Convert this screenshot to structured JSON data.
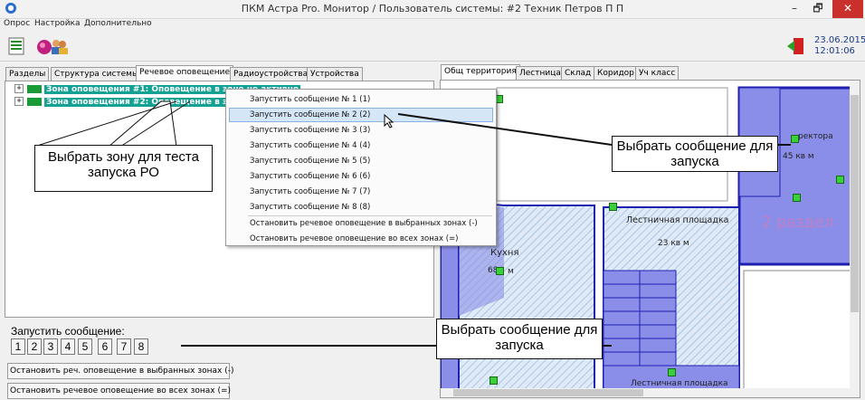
{
  "window": {
    "title": "ПКМ Астра Pro. Монитор / Пользователь системы: #2 Техник Петров П П",
    "controls": {
      "minimize": "–",
      "restore": "🗗",
      "close": "✕"
    }
  },
  "menu": [
    "Опрос",
    "Настройка",
    "Дополнительно"
  ],
  "toolbar": {
    "icons": [
      "list-icon",
      "globe-icon",
      "users-icon",
      "exit-icon"
    ],
    "date": "23.06.2015",
    "time": "12:01:06"
  },
  "left_tabs": [
    "Разделы",
    "Структура системы",
    "Речевое оповещение",
    "Радиоустройства",
    "Устройства"
  ],
  "tree": [
    {
      "label": "Зона оповещения #1: Оповещение в зоне не активно"
    },
    {
      "label": "Зона оповещения #2: Оповещение в зоне не активно"
    }
  ],
  "context_menu": {
    "items": [
      "Запустить сообщение № 1 (1)",
      "Запустить сообщение № 2 (2)",
      "Запустить сообщение № 3 (3)",
      "Запустить сообщение № 4 (4)",
      "Запустить сообщение № 5 (5)",
      "Запустить сообщение № 6 (6)",
      "Запустить сообщение № 7 (7)",
      "Запустить сообщение № 8 (8)"
    ],
    "stop_selected": "Остановить речевое оповещение в выбранных зонах (-)",
    "stop_all": "Остановить речевое оповещение во всех зонах (=)"
  },
  "callouts": {
    "zone": "Выбрать зону для теста запуска РО",
    "message_top": "Выбрать сообщение для запуска",
    "message_bottom": "Выбрать сообщение для запуска"
  },
  "launch": {
    "label": "Запустить сообщение:",
    "buttons": [
      "1",
      "2",
      "3",
      "4",
      "5",
      "6",
      "7",
      "8"
    ],
    "stop_selected": "Остановить реч. оповещение в выбранных зонах (-)",
    "stop_all": "Остановить речевое оповещение во всех зонах (=)"
  },
  "right_tabs": [
    "Общ территория",
    "Лестница",
    "Склад",
    "Коридор",
    "Уч класс"
  ],
  "map": {
    "labels": {
      "director": "ректора",
      "director_area": "45 кв м",
      "stair": "Лестничная площадка",
      "stair_area": "23 кв м",
      "kitchen": "Кухня",
      "kitchen_area": "68",
      "kitchen_unit": "м",
      "section": "2 раздел",
      "stair_bottom": "Лестничная площадка"
    },
    "colors": {
      "zone_fill": "#8a8ee8",
      "zone_border": "#2020b0",
      "hatch": "#b9d4ec",
      "section_text": "#c080c8"
    }
  }
}
